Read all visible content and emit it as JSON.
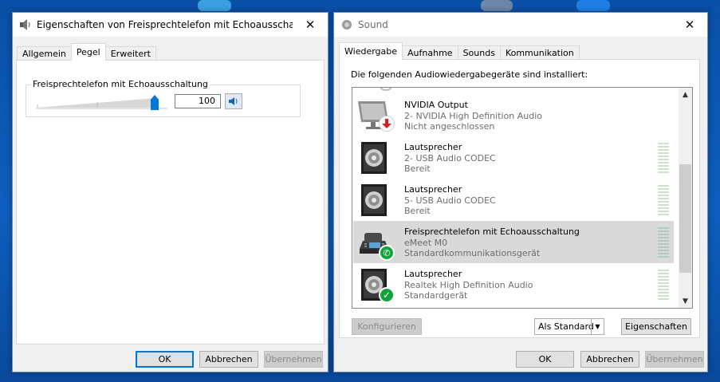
{
  "left_window": {
    "title": "Eigenschaften von Freisprechtelefon mit Echoausschaltung",
    "tabs": [
      "Allgemein",
      "Pegel",
      "Erweitert"
    ],
    "active_tab": "Pegel",
    "level_group": {
      "label": "Freisprechtelefon mit Echoausschaltung",
      "value": "100",
      "level_fraction": 1.0
    },
    "buttons": {
      "ok": "OK",
      "cancel": "Abbrechen",
      "apply": "Übernehmen"
    }
  },
  "right_window": {
    "title": "Sound",
    "tabs": [
      "Wiedergabe",
      "Aufnahme",
      "Sounds",
      "Kommunikation"
    ],
    "active_tab": "Wiedergabe",
    "intro": "Die folgenden Audiowiedergabegeräte sind installiert:",
    "devices": [
      {
        "name": "NVIDIA Output",
        "line2": "2- NVIDIA High Definition Audio",
        "line3": "Nicht angeschlossen",
        "icon": "monitor-icon",
        "badge": "disconnected-arrow-icon"
      },
      {
        "name": "Lautsprecher",
        "line2": "2- USB Audio CODEC",
        "line3": "Bereit",
        "icon": "speaker-icon",
        "badge": ""
      },
      {
        "name": "Lautsprecher",
        "line2": "5- USB Audio CODEC",
        "line3": "Bereit",
        "icon": "speaker-icon",
        "badge": ""
      },
      {
        "name": "Freisprechtelefon mit Echoausschaltung",
        "line2": "eMeet M0",
        "line3": "Standardkommunikationsgerät",
        "icon": "speakerphone-icon",
        "badge": "phone-badge-icon"
      },
      {
        "name": "Lautsprecher",
        "line2": "Realtek High Definition Audio",
        "line3": "Standardgerät",
        "icon": "speaker-icon",
        "badge": "checkmark-badge-icon"
      }
    ],
    "buttons": {
      "configure": "Konfigurieren",
      "set_default": "Als Standard",
      "properties": "Eigenschaften",
      "ok": "OK",
      "cancel": "Abbrechen",
      "apply": "Übernehmen"
    }
  },
  "colors": {
    "accent": "#0078d7",
    "desktop": "#0d5fbf",
    "selection": "#d9d9d9",
    "check_green": "#10a33a",
    "alert_red": "#d81e1e"
  }
}
